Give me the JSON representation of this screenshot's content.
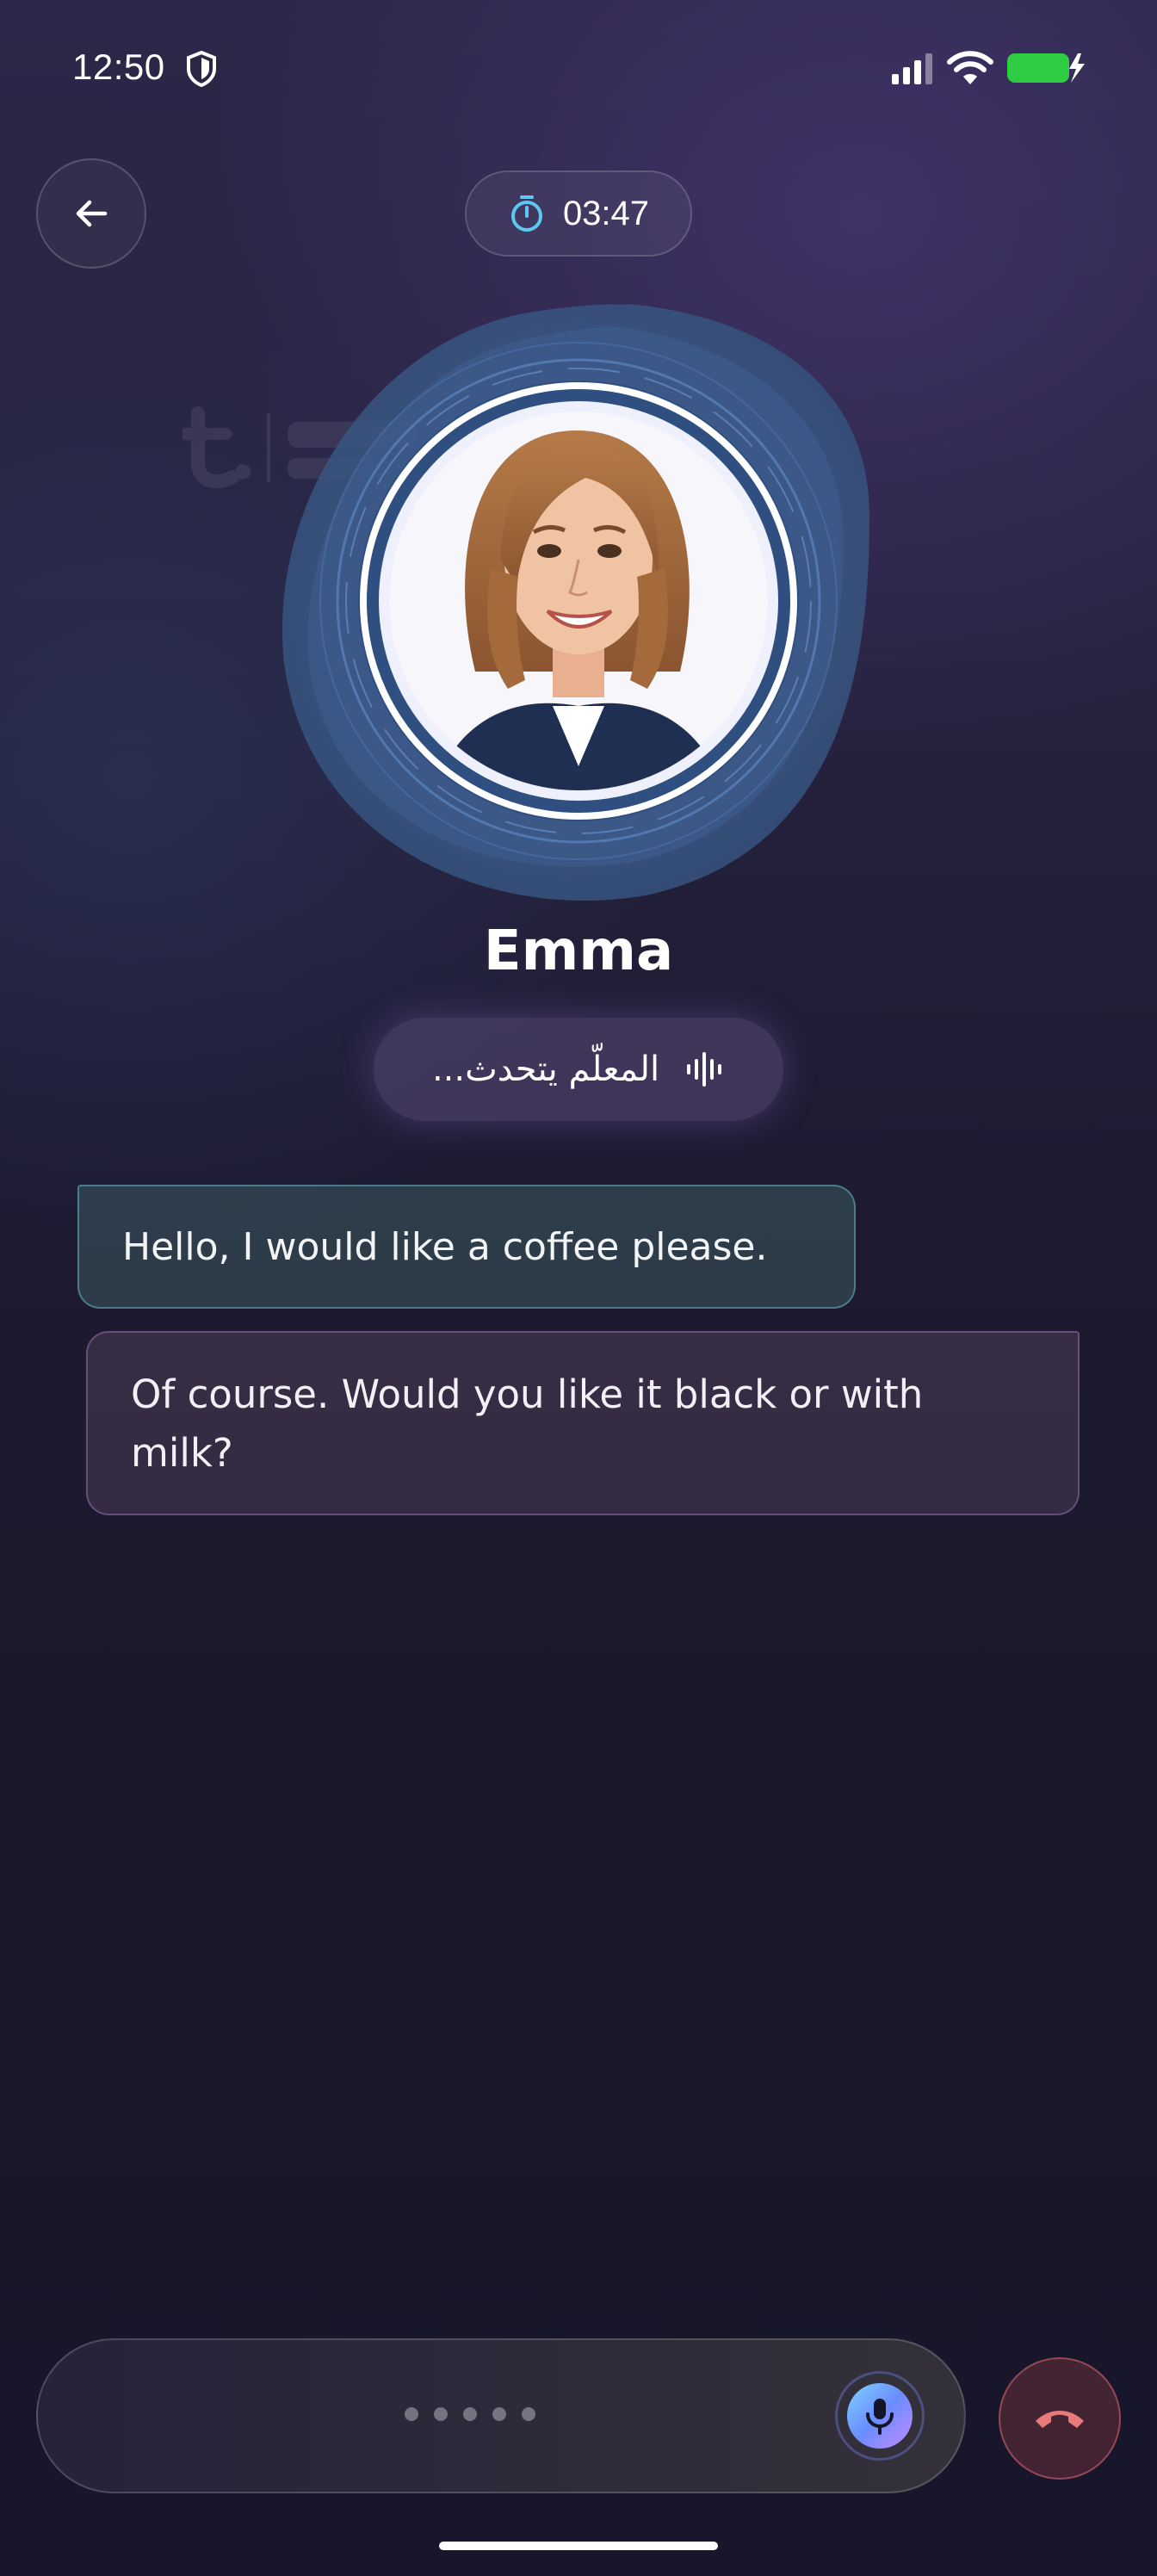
{
  "status_bar": {
    "time": "12:50",
    "icons": [
      "shield-icon",
      "signal-icon",
      "wifi-icon",
      "battery-charging-icon"
    ],
    "battery_color": "#2ecc40"
  },
  "header": {
    "back_icon": "arrow-left-icon",
    "timer_icon": "stopwatch-icon",
    "timer": "03:47"
  },
  "tutor": {
    "name": "Emma",
    "status": "المعلّم يتحدث...",
    "status_icon": "waveform-icon"
  },
  "messages": [
    {
      "role": "user",
      "text": "Hello, I would like a coffee please."
    },
    {
      "role": "tutor",
      "text": "Of course. Would you like it black or with milk?"
    }
  ],
  "controls": {
    "mic_icon": "microphone-icon",
    "hangup_icon": "phone-hangup-icon",
    "accent": "#6a8cff",
    "hangup_color": "#e87a7a"
  }
}
